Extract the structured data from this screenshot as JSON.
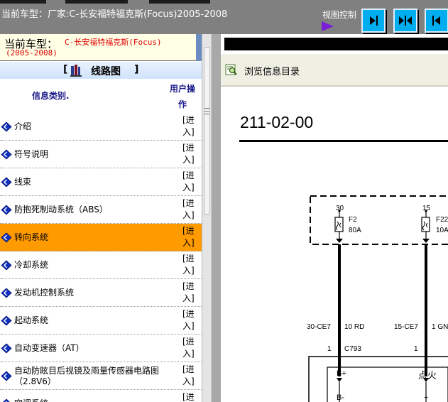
{
  "window": {
    "title": "当前车型：厂家:C-长安福特福克斯(Focus)2005-2008",
    "view_control_label": "视图控制",
    "view_buttons": [
      {
        "name": "expand-right-button",
        "icon": "arrow-right-bar-icon"
      },
      {
        "name": "split-view-button",
        "icon": "split-arrows-icon"
      },
      {
        "name": "expand-left-button",
        "icon": "arrow-left-bar-icon"
      }
    ]
  },
  "model": {
    "label": "当前车型：",
    "value_line1": "C-长安福特福克斯(Focus)",
    "value_line2": "(2005-2008)"
  },
  "section": {
    "bracket_left": "[",
    "title": "线路图",
    "bracket_right": "]"
  },
  "table": {
    "col_category": "信息类别.",
    "col_op_line1": "用户操",
    "col_op_line2": "作",
    "rows": [
      {
        "label": "介绍",
        "enter1": "[进",
        "enter2": "入]",
        "highlighted": false
      },
      {
        "label": "符号说明",
        "enter1": "[进",
        "enter2": "入]",
        "highlighted": false
      },
      {
        "label": "线束",
        "enter1": "[进",
        "enter2": "入]",
        "highlighted": false
      },
      {
        "label": "防抱死制动系统（ABS）",
        "enter1": "[进",
        "enter2": "入]",
        "highlighted": false
      },
      {
        "label": "转向系统",
        "enter1": "[进",
        "enter2": "入]",
        "highlighted": true
      },
      {
        "label": "冷却系统",
        "enter1": "[进",
        "enter2": "入]",
        "highlighted": false
      },
      {
        "label": "发动机控制系统",
        "enter1": "[进",
        "enter2": "入]",
        "highlighted": false
      },
      {
        "label": "起动系统",
        "enter1": "[进",
        "enter2": "入]",
        "highlighted": false
      },
      {
        "label": "自动变速器（AT）",
        "enter1": "[进",
        "enter2": "入]",
        "highlighted": false
      },
      {
        "label": "自动防眩目后视镜及雨量传感器电路图（2.8V6）",
        "enter1": "[进",
        "enter2": "入]",
        "highlighted": false
      },
      {
        "label": "空调系统",
        "enter1": "[进",
        "enter2": "",
        "highlighted": false
      }
    ]
  },
  "viewer": {
    "browse_label": "浏览信息目录",
    "browse_icon": "magnifier-document-icon",
    "doc_code": "211-02-00",
    "fuse1": {
      "pin": "30",
      "name": "F2",
      "rating": "80A",
      "wire_code": "30-CE7",
      "wire_color": "10 RD",
      "connector_pin": "1",
      "connector": "C793",
      "terminal": "B+"
    },
    "fuse2": {
      "pin": "15",
      "name": "F22",
      "rating": "10A",
      "wire_code": "15-CE7",
      "wire_color": "1 GN",
      "connector_pin": "1",
      "terminal": "点火"
    },
    "terminal_b_minus": "B-",
    "plus_sign": "+"
  },
  "colors": {
    "top_bar": "#808080",
    "model_text": "#e00000",
    "highlight_row": "#ff9a00",
    "header_blue": "#1a1a8a",
    "view_button": "#00aeef",
    "arrow_purple": "#7a1fd8"
  }
}
